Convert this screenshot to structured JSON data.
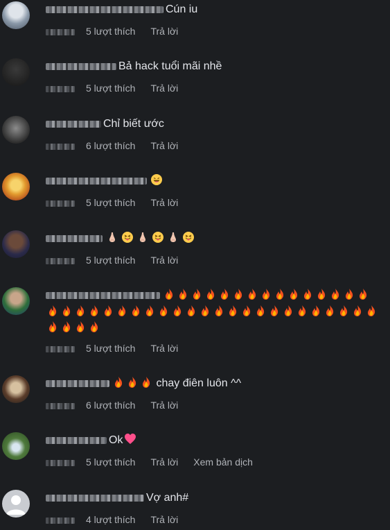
{
  "comments": [
    {
      "text": "Cún iu",
      "likes": "5 lượt thích",
      "reply": "Trả lời"
    },
    {
      "text": "Bả hack tuổi mãi nhề",
      "likes": "5 lượt thích",
      "reply": "Trả lời"
    },
    {
      "text": "Chỉ biết ước",
      "likes": "6 lượt thích",
      "reply": "Trả lời"
    },
    {
      "text": "",
      "likes": "5 lượt thích",
      "reply": "Trả lời"
    },
    {
      "text": "",
      "likes": "5 lượt thích",
      "reply": "Trả lời"
    },
    {
      "text": "",
      "likes": "5 lượt thích",
      "reply": "Trả lời"
    },
    {
      "text": "chay điên luôn ^^",
      "likes": "6 lượt thích",
      "reply": "Trả lời"
    },
    {
      "text": "Ok",
      "likes": "5 lượt thích",
      "reply": "Trả lời",
      "translate": "Xem bản dịch"
    },
    {
      "text": "Vợ anh#",
      "likes": "4 lượt thích",
      "reply": "Trả lời"
    }
  ],
  "colors": {
    "background": "#1c1e21",
    "text": "#e4e6eb",
    "meta": "#b0b3b8"
  },
  "icons": [
    "fire-emoji-icon",
    "grinning-emoji-icon",
    "tongue-emoji-icon",
    "nose-emoji-icon",
    "heart-emoji-icon",
    "default-avatar-icon"
  ]
}
